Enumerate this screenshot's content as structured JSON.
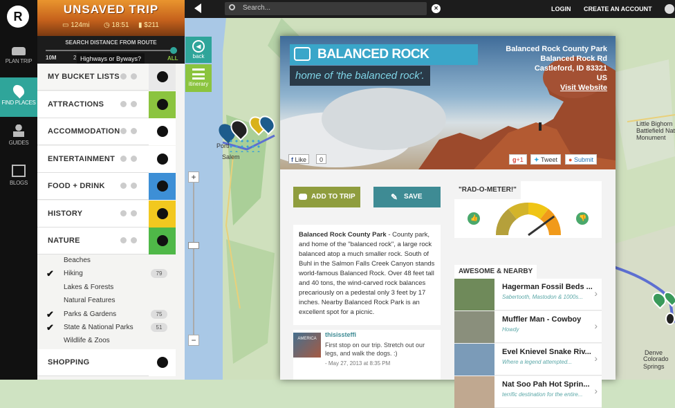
{
  "nav": {
    "items": [
      {
        "label": "Plan Trip",
        "icon": "car-icon"
      },
      {
        "label": "Find Places",
        "icon": "location-pin-icon"
      },
      {
        "label": "Guides",
        "icon": "person-icon"
      },
      {
        "label": "Blogs",
        "icon": "blog-icon"
      }
    ]
  },
  "header": {
    "title": "UNSAVED TRIP",
    "distance": "124mi",
    "time": "18:51",
    "cost": "$211"
  },
  "distance": {
    "label": "SEARCH DISTANCE FROM ROUTE",
    "tooltip": "Highways or Byways?",
    "min": "10M",
    "tick2": "2",
    "max": "ALL"
  },
  "categories": [
    {
      "label": "MY BUCKET LISTS",
      "color": "#e9e9e9"
    },
    {
      "label": "ATTRACTIONS",
      "color": "#8bc43f"
    },
    {
      "label": "ACCOMMODATION",
      "color": "#ffffff"
    },
    {
      "label": "ENTERTAINMENT",
      "color": "#ffffff"
    },
    {
      "label": "FOOD + DRINK",
      "color": "#3d8fd6"
    },
    {
      "label": "HISTORY",
      "color": "#f2c81f"
    },
    {
      "label": "NATURE",
      "color": "#4fb848"
    }
  ],
  "nature_sub": [
    {
      "label": "Beaches",
      "checked": false,
      "count": ""
    },
    {
      "label": "Hiking",
      "checked": true,
      "count": "79"
    },
    {
      "label": "Lakes & Forests",
      "checked": false,
      "count": ""
    },
    {
      "label": "Natural Features",
      "checked": false,
      "count": ""
    },
    {
      "label": "Parks & Gardens",
      "checked": true,
      "count": "75"
    },
    {
      "label": "State & National Parks",
      "checked": true,
      "count": "51"
    },
    {
      "label": "Wildlife & Zoos",
      "checked": false,
      "count": ""
    }
  ],
  "shopping": "SHOPPING",
  "topbar": {
    "search_placeholder": "Search...",
    "login": "LOGIN",
    "create_account": "CREATE AN ACCOUNT"
  },
  "map_tools": {
    "back": "back",
    "itinerary": "itinerary"
  },
  "map_labels": {
    "portland": "Portl",
    "salem": "Salem",
    "denver": "Denve",
    "colorado": "Colorado\nSprings",
    "little_bighorn": "Little Bighorn\nBattlefield National\nMonument"
  },
  "place": {
    "name": "BALANCED ROCK COUNTY PARK",
    "tagline": "home of 'the balanced rock'.",
    "address": [
      "Balanced Rock County Park",
      "Balanced Rock Rd",
      "Castleford, ID 83321",
      "US"
    ],
    "website": "Visit Website",
    "like": "Like",
    "like_count": "0",
    "gplus": "+1",
    "tweet": "Tweet",
    "submit": "Submit",
    "add_to_trip": "ADD TO TRIP",
    "save": "SAVE",
    "description_title": "Balanced Rock County Park",
    "description": " - County park, and home of the \"balanced rock\", a large rock balanced atop a much smaller rock. South of Buhl in the Salmon Falls Creek Canyon stands world-famous Balanced Rock. Over 48 feet tall and 40 tons, the wind-carved rock balances precariously on a pedestal only 3 feet by 17 inches. Nearby Balanced Rock Park is an excellent spot for a picnic."
  },
  "comment": {
    "user": "thisissteffi",
    "text": "First stop on our trip. Stretch out our legs, and walk the dogs. :)",
    "date": "- May 27, 2013 at 8:35 PM",
    "avatar_text": "AMERICA"
  },
  "rad": {
    "title": "\"RAD-O-METER!\"",
    "level": 0.8
  },
  "nearby": {
    "title": "AWESOME & NEARBY",
    "items": [
      {
        "title": "Hagerman Fossil Beds ...",
        "sub": "Sabertooth, Mastodon & 1000s..."
      },
      {
        "title": "Muffler Man - Cowboy",
        "sub": "Howdy"
      },
      {
        "title": "Evel Knievel Snake Riv...",
        "sub": "Where a legend attempted..."
      },
      {
        "title": "Nat Soo Pah Hot Sprin...",
        "sub": "terrific destination for the entire..."
      }
    ]
  }
}
